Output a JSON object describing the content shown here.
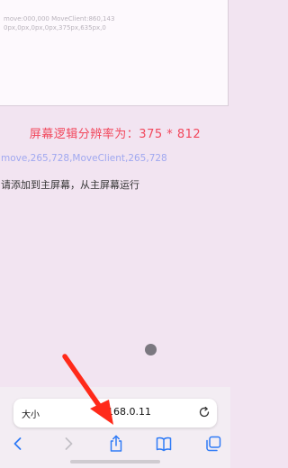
{
  "debug": {
    "line1": "move:000,000 MoveClient:860,143",
    "line2": "0px,0px,0px,0px,375px,635px,0"
  },
  "main": {
    "resolution_text": "屏幕逻辑分辨率为：375 * 812",
    "move_text": "move,265,728,MoveClient,265,728",
    "instruction_text": "请添加到主屏幕，从主屏幕运行"
  },
  "address_bar": {
    "text_size_label": "大小",
    "url": "168.0.11",
    "reload_icon": "reload-icon"
  },
  "toolbar": {
    "icons": [
      "back-icon",
      "forward-icon",
      "share-icon",
      "bookmarks-icon",
      "tabs-icon"
    ]
  },
  "colors": {
    "background": "#f2e4f1",
    "resolution_text": "#f2475c",
    "move_text": "#a0a8f0",
    "link_blue": "#2f7bf6",
    "annotation_arrow": "#ff2a1a"
  }
}
